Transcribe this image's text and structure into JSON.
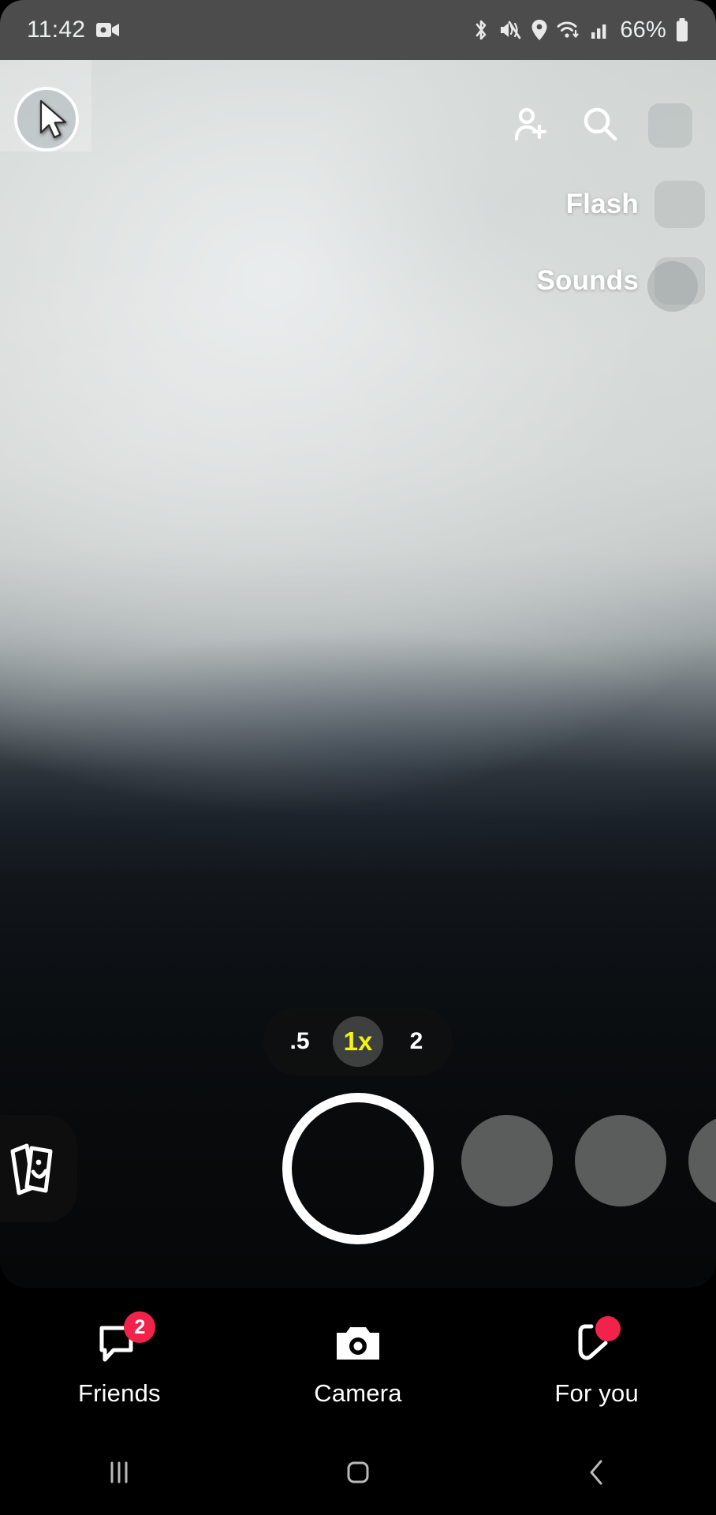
{
  "status_bar": {
    "time": "11:42",
    "battery_percent": "66%",
    "icons": [
      "video-recording-icon",
      "bluetooth-icon",
      "mute-vibrate-icon",
      "location-icon",
      "wifi-icon",
      "cellular-signal-icon",
      "battery-icon"
    ]
  },
  "camera": {
    "avatar_name": "profile-avatar",
    "cursor": "mouse-cursor",
    "top_actions": [
      {
        "name": "add-friend-icon",
        "label": "Add Friend"
      },
      {
        "name": "search-icon",
        "label": "Search"
      },
      {
        "name": "more-options-icon",
        "label": ""
      }
    ],
    "side_menu": [
      {
        "label": "Flash",
        "icon": "flash-icon"
      },
      {
        "label": "Sounds",
        "icon": "sounds-icon"
      }
    ],
    "extra_control": "camera-flip-icon",
    "zoom": {
      "options": [
        {
          "value": ".5",
          "selected": false
        },
        {
          "value": "1x",
          "selected": true
        },
        {
          "value": "2",
          "selected": false
        }
      ],
      "active_color": "#f2f512"
    },
    "shutter": "shutter-button",
    "memories": "memories-icon",
    "lens_count": 3
  },
  "bottom_nav": {
    "items": [
      {
        "label": "Friends",
        "icon": "chat-bubble-icon",
        "badge": "2",
        "badge_color": "#f2234b",
        "active": false
      },
      {
        "label": "Camera",
        "icon": "camera-icon",
        "badge": "",
        "active": true
      },
      {
        "label": "For you",
        "icon": "spotlight-play-icon",
        "badge": "",
        "dot": true,
        "badge_color": "#f2234b",
        "active": false
      }
    ]
  },
  "android_nav": {
    "recents": "recents-icon",
    "home": "home-icon",
    "back": "back-icon"
  }
}
